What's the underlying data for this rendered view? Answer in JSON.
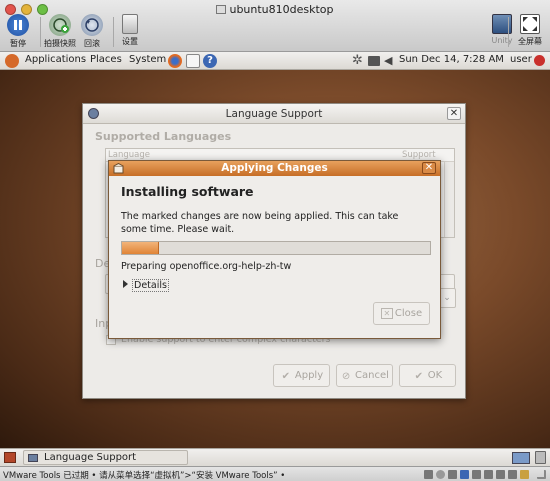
{
  "vmware": {
    "window_title": "ubuntu810desktop",
    "toolbar": {
      "pause_label": "暂停",
      "snapshot_label": "拍摄快照",
      "revert_label": "回滚",
      "settings_label": "设置",
      "unity_label": "Unity",
      "fullscreen_label": "全屏幕"
    },
    "status_message": "VMware Tools 已过期 • 请从菜单选择“虚拟机”>“安装 VMware Tools” •"
  },
  "gnome_panel": {
    "menus": [
      "Applications",
      "Places",
      "System"
    ],
    "clock": "Sun Dec 14,  7:28 AM",
    "user": "user"
  },
  "language_support": {
    "title": "Language Support",
    "supported_languages_label": "Supported Languages",
    "list_columns": [
      "Language",
      "Support"
    ],
    "default_language_label": "De",
    "input_method_label": "Inp",
    "input_method_option": "Enable support to enter complex characters",
    "buttons": {
      "apply": "Apply",
      "cancel": "Cancel",
      "ok": "OK"
    }
  },
  "applying_changes": {
    "title": "Applying Changes",
    "heading": "Installing software",
    "message": "The marked changes are now being applied. This can take some time. Please wait.",
    "progress": 0.12,
    "status": "Preparing openoffice.org-help-zh-tw",
    "details_label": "Details",
    "close_label": "Close"
  },
  "taskbar": {
    "item_label": "Language Support"
  },
  "colors": {
    "dialog_title_accent": "#d9782e",
    "progress_fill": "#e08436"
  }
}
